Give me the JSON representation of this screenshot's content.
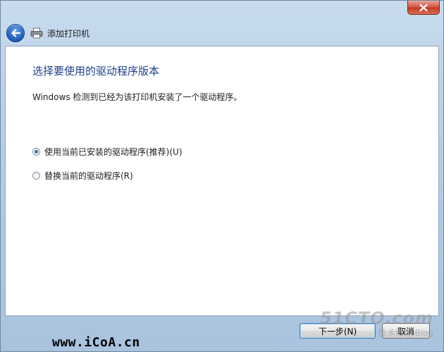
{
  "window": {
    "title": "添加打印机"
  },
  "page": {
    "heading": "选择要使用的驱动程序版本",
    "description": "Windows 检测到已经为该打印机安装了一个驱动程序。"
  },
  "options": [
    {
      "label": "使用当前已安装的驱动程序(推荐)(U)",
      "checked": true
    },
    {
      "label": "替换当前的驱动程序(R)",
      "checked": false
    }
  ],
  "watermark": {
    "text": "www.iCoA.cn"
  },
  "corner_watermark": {
    "main": "51CTO.com",
    "sub": "技术博客 Blog"
  },
  "buttons": {
    "next_label": "下一步(N)",
    "cancel_label": "取消"
  },
  "icons": {
    "close": "close-icon",
    "back": "back-arrow-icon",
    "printer": "printer-icon"
  },
  "colors": {
    "heading": "#1d3f8a",
    "close_button": "#c23b22",
    "back_button": "#2a67c2"
  }
}
